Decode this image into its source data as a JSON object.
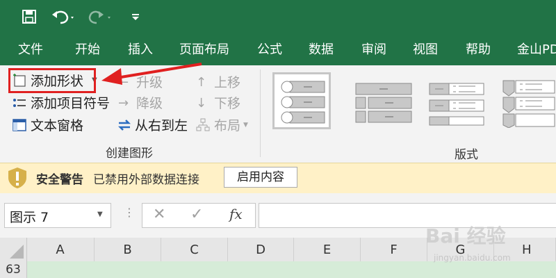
{
  "quick_access": {
    "save_icon": "save-icon",
    "undo_icon": "undo-icon",
    "redo_icon": "redo-icon",
    "customize_icon": "customize-icon"
  },
  "menu": {
    "items": [
      "文件",
      "开始",
      "插入",
      "页面布局",
      "公式",
      "数据",
      "审阅",
      "视图",
      "帮助",
      "金山PDF"
    ]
  },
  "ribbon": {
    "add_shape": "添加形状",
    "add_bullet": "添加项目符号",
    "text_pane": "文本窗格",
    "promote": "升级",
    "demote": "降级",
    "right_to_left": "从右到左",
    "move_up": "上移",
    "move_down": "下移",
    "layout": "布局",
    "group_create": "创建图形",
    "group_layouts": "版式"
  },
  "security": {
    "title": "安全警告",
    "message": "已禁用外部数据连接",
    "button": "启用内容"
  },
  "formula_bar": {
    "name_box": "图示 7",
    "cancel_icon": "cancel-icon",
    "enter_icon": "enter-icon",
    "fx": "fx",
    "formula_value": ""
  },
  "grid": {
    "columns": [
      "A",
      "B",
      "C",
      "D",
      "E",
      "F",
      "G",
      "H"
    ],
    "row": "63"
  },
  "colors": {
    "brand_green": "#217346",
    "highlight_red": "#e02020",
    "warning_bg": "#fff1c7"
  },
  "watermark": {
    "brand": "Bai 经验",
    "url": "jingyan.baidu.com"
  }
}
